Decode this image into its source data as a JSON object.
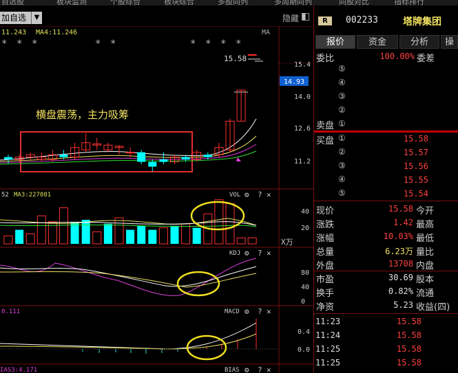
{
  "top_tabs": [
    "自选股",
    "板块监测",
    "个股综合",
    "板块综合",
    "多股同列",
    "多周期同列",
    "同股对比",
    "指标排行"
  ],
  "toolbar": {
    "add_label": "加自选",
    "hide_label": "隐藏"
  },
  "chart_data": [
    {
      "type": "candlestick",
      "panel": "price",
      "ma_labels": {
        "ma3": "11.243",
        "ma4": "MA4:11.246",
        "ma_tag": "MA"
      },
      "y_ticks": [
        "15.4",
        "14.0",
        "12.6",
        "11.2"
      ],
      "current_price_tag": "14.93",
      "high_label": "15.58",
      "annotation": "横盘震荡，主力吸筹",
      "ylim": [
        10.4,
        16.2
      ],
      "candles": [
        {
          "o": 11.3,
          "c": 11.2,
          "h": 11.4,
          "l": 11.0
        },
        {
          "o": 11.2,
          "c": 11.3,
          "h": 11.4,
          "l": 11.1
        },
        {
          "o": 11.3,
          "c": 11.4,
          "h": 11.5,
          "l": 11.2
        },
        {
          "o": 11.2,
          "c": 11.3,
          "h": 11.5,
          "l": 11.1
        },
        {
          "o": 11.2,
          "c": 11.4,
          "h": 11.6,
          "l": 11.1
        },
        {
          "o": 11.4,
          "c": 11.3,
          "h": 11.6,
          "l": 11.2
        },
        {
          "o": 11.3,
          "c": 11.7,
          "h": 11.9,
          "l": 11.2
        },
        {
          "o": 11.6,
          "c": 11.9,
          "h": 12.3,
          "l": 11.5
        },
        {
          "o": 11.8,
          "c": 11.85,
          "h": 12.1,
          "l": 11.6
        },
        {
          "o": 11.6,
          "c": 11.8,
          "h": 11.9,
          "l": 11.5
        },
        {
          "o": 11.7,
          "c": 11.75,
          "h": 11.8,
          "l": 11.4
        },
        {
          "o": 11.5,
          "c": 11.5,
          "h": 11.7,
          "l": 11.3
        },
        {
          "o": 11.5,
          "c": 11.1,
          "h": 11.6,
          "l": 11.0
        },
        {
          "o": 11.1,
          "c": 10.9,
          "h": 11.2,
          "l": 10.7
        },
        {
          "o": 11.2,
          "c": 11.1,
          "h": 11.5,
          "l": 11.0
        },
        {
          "o": 11.1,
          "c": 11.3,
          "h": 11.4,
          "l": 11.0
        },
        {
          "o": 11.3,
          "c": 11.2,
          "h": 11.4,
          "l": 11.1
        },
        {
          "o": 11.2,
          "c": 11.5,
          "h": 11.6,
          "l": 11.1
        },
        {
          "o": 11.4,
          "c": 11.3,
          "h": 11.5,
          "l": 11.2
        },
        {
          "o": 11.4,
          "c": 11.7,
          "h": 11.9,
          "l": 11.3
        },
        {
          "o": 11.6,
          "c": 12.8,
          "h": 12.9,
          "l": 11.5
        },
        {
          "o": 12.8,
          "c": 14.1,
          "h": 14.1,
          "l": 12.8
        },
        {
          "o": 15.58,
          "c": 15.58,
          "h": 15.58,
          "l": 15.58
        }
      ]
    },
    {
      "type": "bar",
      "panel": "volume",
      "title": "VOL",
      "label_left": "52",
      "ma_label": "MA3:227081",
      "y_ticks": [
        "40",
        "20"
      ],
      "unit": "X万",
      "ylim": [
        0,
        50
      ],
      "values": [
        8,
        14,
        10,
        28,
        22,
        36,
        22,
        24,
        12,
        20,
        26,
        14,
        18,
        14,
        16,
        18,
        20,
        16,
        30,
        44,
        40,
        6,
        6
      ],
      "colors": [
        "r",
        "c",
        "r",
        "r",
        "r",
        "r",
        "c",
        "c",
        "r",
        "c",
        "r",
        "c",
        "c",
        "c",
        "r",
        "c",
        "r",
        "c",
        "r",
        "r",
        "r",
        "r",
        "r"
      ]
    },
    {
      "type": "line",
      "panel": "kdj",
      "title": "KDJ",
      "y_ticks": [
        "80",
        "40",
        "0"
      ],
      "ylim": [
        -10,
        110
      ]
    },
    {
      "type": "bar",
      "panel": "macd",
      "title": "MACD",
      "label_left": "0.111",
      "y_ticks": [
        "0.4",
        "0.0"
      ],
      "ylim": [
        -0.1,
        0.5
      ]
    },
    {
      "type": "line",
      "panel": "bias",
      "title": "BIAS",
      "label_left": "IAS3:4.171"
    }
  ],
  "stock": {
    "code": "002233",
    "name": "塔牌集团",
    "badge": "R"
  },
  "info_tabs": [
    "报价",
    "资金",
    "分析",
    "操"
  ],
  "order_book": {
    "weibi_label": "委比",
    "weibi_value": "100.00%",
    "weicha_label": "委差",
    "sell_label": "卖盘",
    "sell_levels": [
      "⑤",
      "④",
      "③",
      "②",
      "①"
    ],
    "buy_label": "买盘",
    "buy_levels": [
      {
        "level": "①",
        "price": "15.58"
      },
      {
        "level": "②",
        "price": "15.57"
      },
      {
        "level": "③",
        "price": "15.56"
      },
      {
        "level": "④",
        "price": "15.55"
      },
      {
        "level": "⑤",
        "price": "15.54"
      }
    ]
  },
  "quote": [
    {
      "label": "现价",
      "value": "15.58",
      "label2": "今开",
      "color": "red"
    },
    {
      "label": "涨跌",
      "value": "1.42",
      "label2": "最高",
      "color": "red"
    },
    {
      "label": "涨幅",
      "value": "10.03%",
      "label2": "最低",
      "color": "red"
    },
    {
      "label": "总量",
      "value": "6.23万",
      "label2": "量比",
      "color": "yel"
    },
    {
      "label": "外盘",
      "value": "13708",
      "label2": "内盘",
      "color": "red"
    },
    {
      "label": "市盈",
      "value": "30.69",
      "label2": "股本",
      "color": "white"
    },
    {
      "label": "换手",
      "value": "0.82%",
      "label2": "流通",
      "color": "white"
    },
    {
      "label": "净资",
      "value": "5.23",
      "label2": "收益(四)",
      "color": "white"
    }
  ],
  "ticks": [
    {
      "time": "11:23",
      "price": "15.58"
    },
    {
      "time": "11:24",
      "price": "15.58"
    },
    {
      "time": "11:25",
      "price": "15.58"
    },
    {
      "time": "11:25",
      "price": "15.58"
    }
  ],
  "colors": {
    "up": "#ff3030",
    "down": "#00ffff",
    "annot_box": "#e03030",
    "highlight": "#f0e020",
    "text_yellow": "#f0e060"
  }
}
